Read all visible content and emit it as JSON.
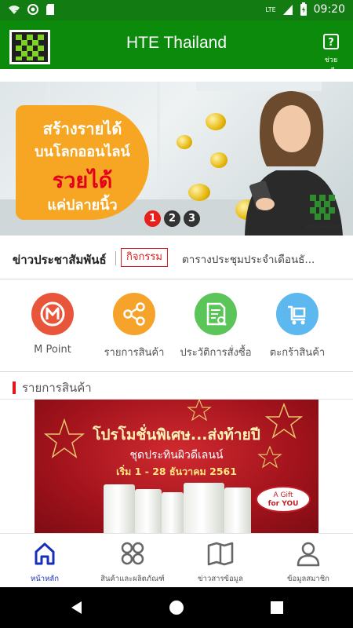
{
  "status_bar": {
    "network_label": "LTE",
    "time": "09:20"
  },
  "app_bar": {
    "title": "HTE Thailand",
    "help_label": "ช่วยเหลือ",
    "help_icon": "question-icon"
  },
  "banner": {
    "line1": "สร้างรายได้",
    "line2": "บนโลกออนไลน์",
    "line3": "รวยได้",
    "line4": "แค่ปลายนิ้ว",
    "logo_text": "HTE THAILAND",
    "pages": [
      "1",
      "2",
      "3"
    ],
    "active_page": "1"
  },
  "news": {
    "title": "ข่าวประชาสัมพันธ์",
    "tag": "กิจกรรม",
    "text": "ตารางประชุมประจำเดือนธั..."
  },
  "shortcuts": [
    {
      "label": "M Point",
      "icon": "m-point-icon",
      "color": "#e8553a"
    },
    {
      "label": "รายการสินค้า",
      "icon": "share-nodes-icon",
      "color": "#f5a32a"
    },
    {
      "label": "ประวัติการสั่งซื้อ",
      "icon": "order-history-icon",
      "color": "#5cc55a"
    },
    {
      "label": "ตะกร้าสินค้า",
      "icon": "cart-icon",
      "color": "#5cb8ee"
    }
  ],
  "section": {
    "title": "รายการสินค้า"
  },
  "promo": {
    "title": "โปรโมชั่นพิเศษ...ส่งท้ายปี",
    "subtitle": "ชุดประทินผิวดีเลนน์",
    "date": "เริ่ม 1 - 28 ธันวาคม 2561",
    "gift_line1": "A Gift",
    "gift_line2": "for YOU"
  },
  "bottom_nav": [
    {
      "label": "หน้าหลัก",
      "icon": "home-icon",
      "active": true
    },
    {
      "label": "สินค้าและผลิตภัณฑ์",
      "icon": "grid-icon",
      "active": false
    },
    {
      "label": "ข่าวสารข้อมูล",
      "icon": "book-icon",
      "active": false
    },
    {
      "label": "ข้อมูลสมาชิก",
      "icon": "user-icon",
      "active": false
    }
  ],
  "colors": {
    "primary_green": "#0b8a0b",
    "status_green": "#127c12",
    "accent_red": "#e21818",
    "nav_active": "#1a2fb8"
  }
}
